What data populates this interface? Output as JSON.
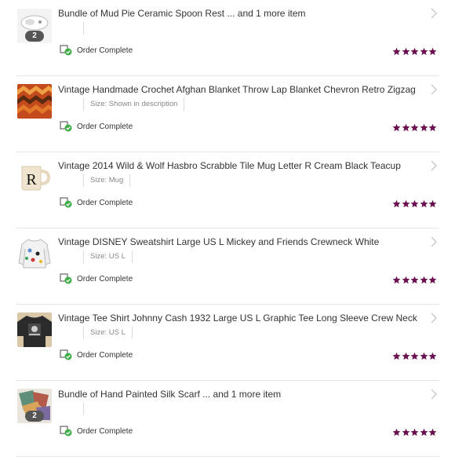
{
  "orders": [
    {
      "title": "Bundle of Mud Pie Ceramic Spoon Rest ... and 1 more item",
      "variant": "",
      "count_badge": "2",
      "status": "Order Complete",
      "rating": 5,
      "thumb": "spoon-rest"
    },
    {
      "title": "Vintage Handmade Crochet Afghan Blanket Throw Lap Blanket Chevron Retro Zigzag",
      "variant": "Size: Shown in description",
      "count_badge": "",
      "status": "Order Complete",
      "rating": 5,
      "thumb": "blanket"
    },
    {
      "title": "Vintage 2014 Wild & Wolf Hasbro Scrabble Tile Mug Letter R Cream Black Teacup",
      "variant": "Size: Mug",
      "count_badge": "",
      "status": "Order Complete",
      "rating": 5,
      "thumb": "mug",
      "thumb_letter": "R"
    },
    {
      "title": "Vintage DISNEY Sweatshirt Large US L Mickey and Friends Crewneck White",
      "variant": "Size: US L",
      "count_badge": "",
      "status": "Order Complete",
      "rating": 5,
      "thumb": "sweatshirt"
    },
    {
      "title": "Vintage Tee Shirt Johnny Cash 1932 Large US L Graphic Tee Long Sleeve Crew Neck",
      "variant": "Size: US L",
      "count_badge": "",
      "status": "Order Complete",
      "rating": 5,
      "thumb": "tee"
    },
    {
      "title": "Bundle of Hand Painted Silk Scarf ... and 1 more item",
      "variant": "",
      "count_badge": "2",
      "status": "Order Complete",
      "rating": 5,
      "thumb": "scarf"
    }
  ],
  "colors": {
    "star": "#6b1050",
    "status_check": "#3fae49",
    "badge": "#555555"
  },
  "icons": {
    "chevron": "chevron-right-icon",
    "status": "package-check-icon",
    "star": "star-icon"
  }
}
